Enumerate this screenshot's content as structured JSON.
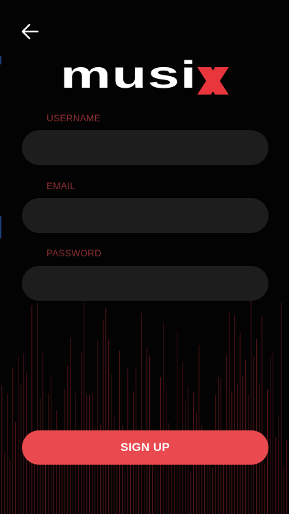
{
  "header": {
    "back_icon": "arrow-left-icon"
  },
  "logo": {
    "text": "musiX",
    "main_color": "#ffffff",
    "accent_color": "#e8363c"
  },
  "form": {
    "username": {
      "label": "USERNAME",
      "value": "",
      "placeholder": ""
    },
    "email": {
      "label": "EMAIL",
      "value": "",
      "placeholder": ""
    },
    "password": {
      "label": "PASSWORD",
      "value": "",
      "placeholder": ""
    }
  },
  "signup_button": {
    "label": "SIGN UP",
    "color": "#e84a4f"
  },
  "colors": {
    "background": "#030303",
    "field_background": "#1d1d1e",
    "label": "#8e2f33",
    "spectrum": "#5a1519"
  }
}
